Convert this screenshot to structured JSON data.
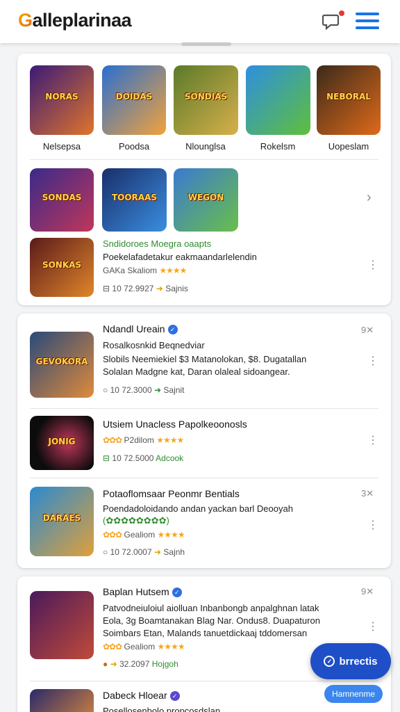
{
  "header": {
    "brand_initial": "G",
    "brand_rest": "alleplarinaa",
    "notification_icon": "chat-bubble-icon",
    "menu_icon": "hamburger-icon",
    "accent": "#1a73e8"
  },
  "featured_row": [
    {
      "label": "Nelsepsa",
      "art_text": "NORAS",
      "colors": [
        "#3b1a78",
        "#e0742a"
      ]
    },
    {
      "label": "Poodsa",
      "art_text": "DOIDAS",
      "colors": [
        "#2a6fd1",
        "#f2a23a"
      ]
    },
    {
      "label": "Nlounglsa",
      "art_text": "SONDIAS",
      "colors": [
        "#5a7a2a",
        "#d8b04a"
      ]
    },
    {
      "label": "Rokelsm",
      "art_text": "",
      "colors": [
        "#2e8fe0",
        "#5fbf3a"
      ]
    },
    {
      "label": "Uopeslam",
      "art_text": "NEBORAL",
      "colors": [
        "#3a2a1a",
        "#e06a1a"
      ]
    }
  ],
  "second_row": [
    {
      "art_text": "SONDAS",
      "colors": [
        "#3a2a8a",
        "#c0365a"
      ]
    },
    {
      "art_text": "TOORAAS",
      "colors": [
        "#1a2e6a",
        "#3a8ee0"
      ]
    },
    {
      "art_text": "WEGON",
      "colors": [
        "#3a7ad0",
        "#6abf4a"
      ]
    }
  ],
  "card1_item": {
    "art_text": "SONKAS",
    "colors": [
      "#5a1a1a",
      "#e0862a"
    ],
    "line1": "Sndidoroes Moegra oaapts",
    "line2": "Poekelafadetakur eakmaandarlelendin",
    "rating_label": "GAKa Skaliom",
    "stars": "★★★★",
    "meta_count": "10 72.9927",
    "meta_tag": "Sajnis"
  },
  "list": [
    {
      "title": "Ndandl Ureain",
      "verified": true,
      "close": "9✕",
      "art_text": "GEVOKORA",
      "colors": [
        "#2a4a7a",
        "#e08a3a"
      ],
      "line1": "Rosalkosnkid Beqnedviar",
      "line2": "Slobils Neemiekiel $3 Matanolokan, $8. Dugatallan",
      "line3": "Solalan Madgne kat, Daran olaleal sidoangear.",
      "meta_count": "10 72.3000",
      "meta_tag": "Sajnit"
    },
    {
      "title": "Utsiem Unacless Papolkeoonosls",
      "verified": false,
      "close": "",
      "art_text": "JONIG",
      "colors": [
        "#0c0c0c",
        "#c0365a"
      ],
      "line1": "",
      "line2": "",
      "line3": "",
      "rating_label": "P2dilom",
      "stars": "★★★★",
      "meta_count": "10 72.5000",
      "meta_tag": "Adcook"
    },
    {
      "title": "Potaoflomsaar Peonmr Bentials",
      "verified": true,
      "close": "3✕",
      "art_text": "DARAES",
      "colors": [
        "#2a8ad0",
        "#e0a03a"
      ],
      "line1": "Poendadoloidando andan yackan barl Deooyah",
      "line2": "(✿✿✿✿✿✿✿✿)",
      "line3": "",
      "rating_label": "Gealiom",
      "stars": "★★★★",
      "meta_count": "10 72.0007",
      "meta_tag": "Sajnh"
    },
    {
      "title": "Baplan Hutsem",
      "verified": true,
      "close": "9✕",
      "art_text": "",
      "colors": [
        "#4a1a5a",
        "#c04a3a"
      ],
      "line1": "Patvodneiuloiul aiolluan Inbanbongb anpalghnan latak",
      "line2": "Eola, 3g Boamtanakan Blag Nar. Ondus8. Duapaturon",
      "line3": "Soimbars Etan, Malands tanuetdickaaj tddomersan",
      "rating_label": "Gealiom",
      "stars": "★★★★",
      "meta_count": "32.2097",
      "meta_tag": "Hojgoh"
    },
    {
      "title": "Dabeck Hloear",
      "verified": true,
      "line1": "Posellosenbolo propcosdslan"
    }
  ],
  "fab": {
    "label": "brrectis",
    "icon": "check-circle-icon"
  },
  "pill": {
    "label": "Hamnenme"
  }
}
